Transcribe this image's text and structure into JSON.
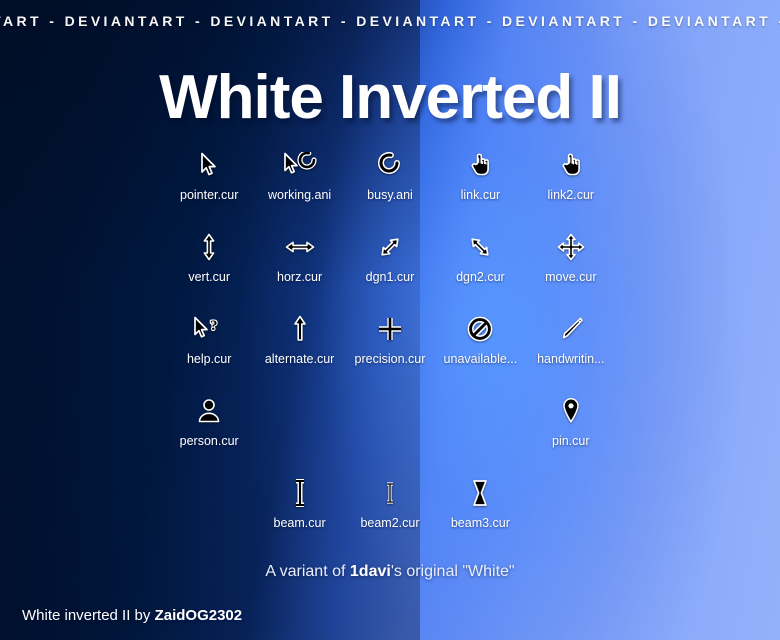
{
  "banner": {
    "text": "VIANTART  -  DEVIANTART  -  DEVIANTART  -  DEVIANTART  -  DEVIANTART  -  DEVIANTART  -  DEVIANTART  -  DEVIANTAR"
  },
  "title": "White Inverted II",
  "grid": {
    "rows": [
      {
        "cells": [
          {
            "icon": "pointer-cursor-icon",
            "label": "pointer.cur"
          },
          {
            "icon": "working-cursor-icon",
            "label": "working.ani"
          },
          {
            "icon": "busy-cursor-icon",
            "label": "busy.ani"
          },
          {
            "icon": "link-hand-cursor-icon",
            "label": "link.cur"
          },
          {
            "icon": "link2-hand-cursor-icon",
            "label": "link2.cur"
          }
        ]
      },
      {
        "cells": [
          {
            "icon": "resize-vertical-cursor-icon",
            "label": "vert.cur"
          },
          {
            "icon": "resize-horizontal-cursor-icon",
            "label": "horz.cur"
          },
          {
            "icon": "resize-diagonal1-cursor-icon",
            "label": "dgn1.cur"
          },
          {
            "icon": "resize-diagonal2-cursor-icon",
            "label": "dgn2.cur"
          },
          {
            "icon": "move-cursor-icon",
            "label": "move.cur"
          }
        ]
      },
      {
        "cells": [
          {
            "icon": "help-cursor-icon",
            "label": "help.cur"
          },
          {
            "icon": "alternate-arrow-cursor-icon",
            "label": "alternate.cur"
          },
          {
            "icon": "precision-crosshair-cursor-icon",
            "label": "precision.cur"
          },
          {
            "icon": "unavailable-cursor-icon",
            "label": "unavailable..."
          },
          {
            "icon": "handwriting-pen-cursor-icon",
            "label": "handwritin..."
          }
        ]
      },
      {
        "cells": [
          {
            "icon": "person-cursor-icon",
            "label": "person.cur"
          },
          {
            "icon": "",
            "label": ""
          },
          {
            "icon": "",
            "label": ""
          },
          {
            "icon": "",
            "label": ""
          },
          {
            "icon": "pin-cursor-icon",
            "label": "pin.cur"
          }
        ]
      },
      {
        "cells": [
          {
            "icon": "",
            "label": ""
          },
          {
            "icon": "text-beam-cursor-icon",
            "label": "beam.cur"
          },
          {
            "icon": "text-beam2-cursor-icon",
            "label": "beam2.cur"
          },
          {
            "icon": "text-beam3-cursor-icon",
            "label": "beam3.cur"
          },
          {
            "icon": "",
            "label": ""
          }
        ]
      }
    ]
  },
  "variant": {
    "prefix": "A variant of ",
    "author": "1davi",
    "suffix": "'s original \"White\""
  },
  "credit": {
    "prefix": "White inverted II by ",
    "author": "ZaidOG2302"
  },
  "colors": {
    "background_dark": "#00112f",
    "background_glow": "#5696ff",
    "background_light": "#93b0fb",
    "text": "#ffffff",
    "cursor_fill": "#000000",
    "cursor_stroke": "#ffffff"
  }
}
